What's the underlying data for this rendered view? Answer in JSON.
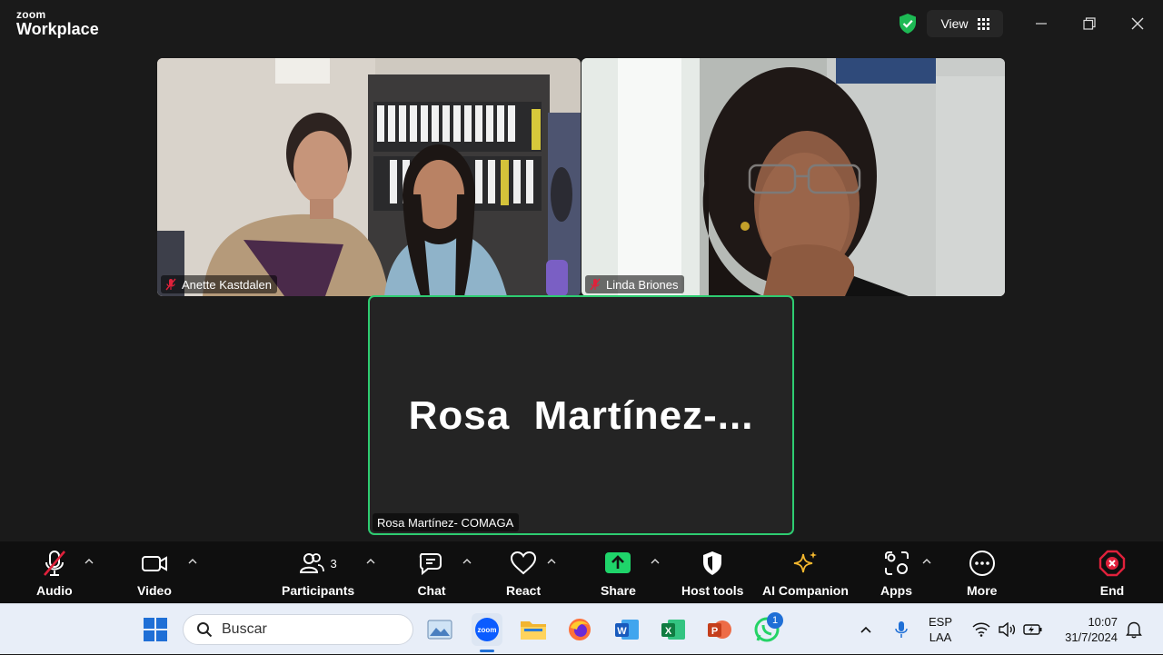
{
  "app": {
    "brand_top": "zoom",
    "brand_bottom": "Workplace",
    "view_label": "View"
  },
  "participants": [
    {
      "name": "Anette Kastdalen",
      "muted": true
    },
    {
      "name": "Linda Briones",
      "muted": true
    },
    {
      "name": "Rosa Martínez- COMAGA",
      "muted": false,
      "display_name": "Rosa  Martínez-...",
      "active_speaker": true
    }
  ],
  "toolbar": {
    "audio": "Audio",
    "video": "Video",
    "participants": "Participants",
    "participants_count": "3",
    "chat": "Chat",
    "react": "React",
    "share": "Share",
    "host_tools": "Host tools",
    "ai_companion": "AI Companion",
    "apps": "Apps",
    "more": "More",
    "end": "End"
  },
  "taskbar": {
    "search_placeholder": "Buscar",
    "apps": [
      "start-icon",
      "search-icon",
      "photos-icon",
      "zoom-icon",
      "file-explorer-icon",
      "firefox-icon",
      "word-icon",
      "excel-icon",
      "powerpoint-icon",
      "whatsapp-icon"
    ],
    "whatsapp_badge": "1",
    "lang_top": "ESP",
    "lang_bottom": "LAA",
    "time": "10:07",
    "date": "31/7/2024"
  },
  "colors": {
    "active_border": "#2ecc71",
    "share_green": "#1fd46a",
    "end_red": "#e0213b",
    "ai_gold": "#f5b82e"
  }
}
